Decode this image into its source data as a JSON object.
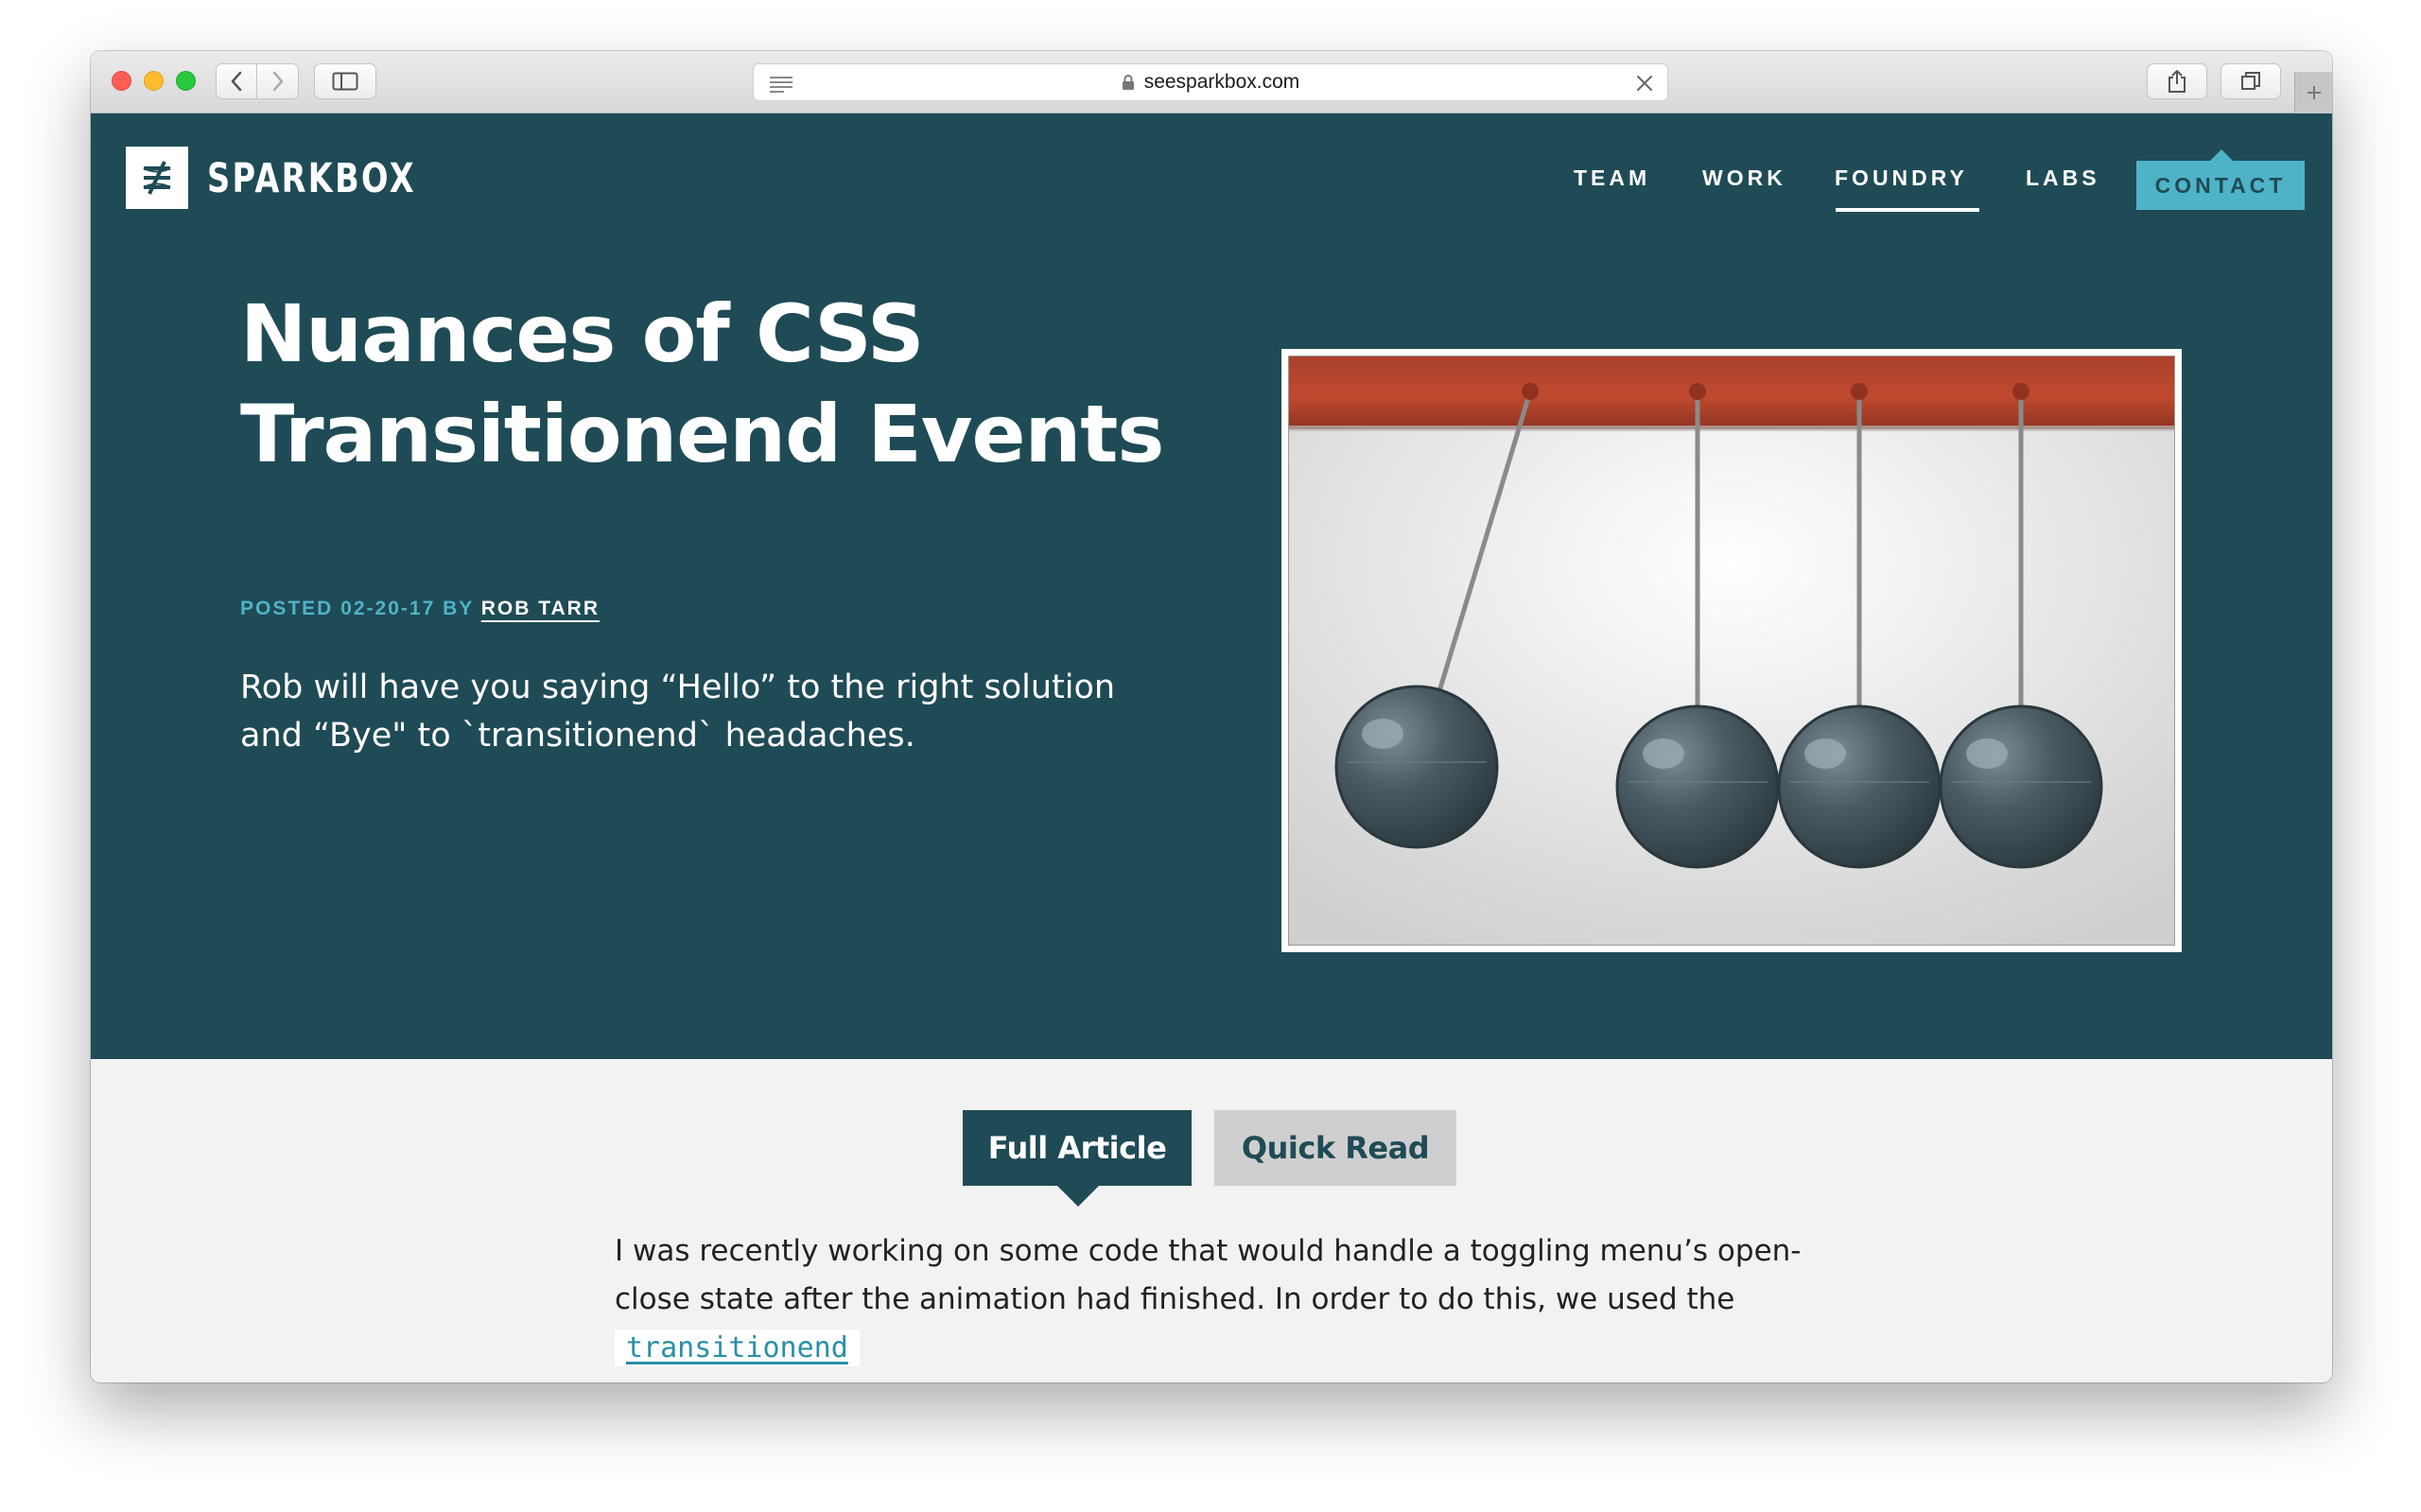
{
  "browser": {
    "url": "seesparkbox.com",
    "colors": {
      "close": "#fc5e56",
      "minimize": "#fdbd2e",
      "zoom": "#28c83f"
    },
    "icons": [
      "back-icon",
      "forward-icon",
      "sidebar-icon",
      "reader-icon",
      "lock-icon",
      "close-icon",
      "share-icon",
      "tabs-icon",
      "plus-icon"
    ]
  },
  "site": {
    "logo_text": "SPARKBOX",
    "nav": {
      "team": "TEAM",
      "work": "WORK",
      "foundry": "FOUNDRY",
      "labs": "LABS",
      "contact": "CONTACT",
      "active": "FOUNDRY"
    },
    "colors": {
      "hero_bg": "#1f4b56",
      "accent": "#4fb3c8",
      "content_bg": "#f2f2f2"
    }
  },
  "post": {
    "title_line1": "Nuances of CSS",
    "title_line2": "Transitionend Events",
    "posted_label": "POSTED 02-20-17 BY",
    "author": "ROB TARR",
    "summary": "Rob will have you saying “Hello” to the right solution and “Bye\" to `transitionend` headaches."
  },
  "tabs": {
    "full": "Full Article",
    "quick": "Quick Read",
    "selected": "Full Article"
  },
  "article": {
    "text": "I was recently working on some code that would handle a toggling menu’s open-close state after the animation had finished. In order to do this, we used the",
    "code_link": "transitionend"
  }
}
